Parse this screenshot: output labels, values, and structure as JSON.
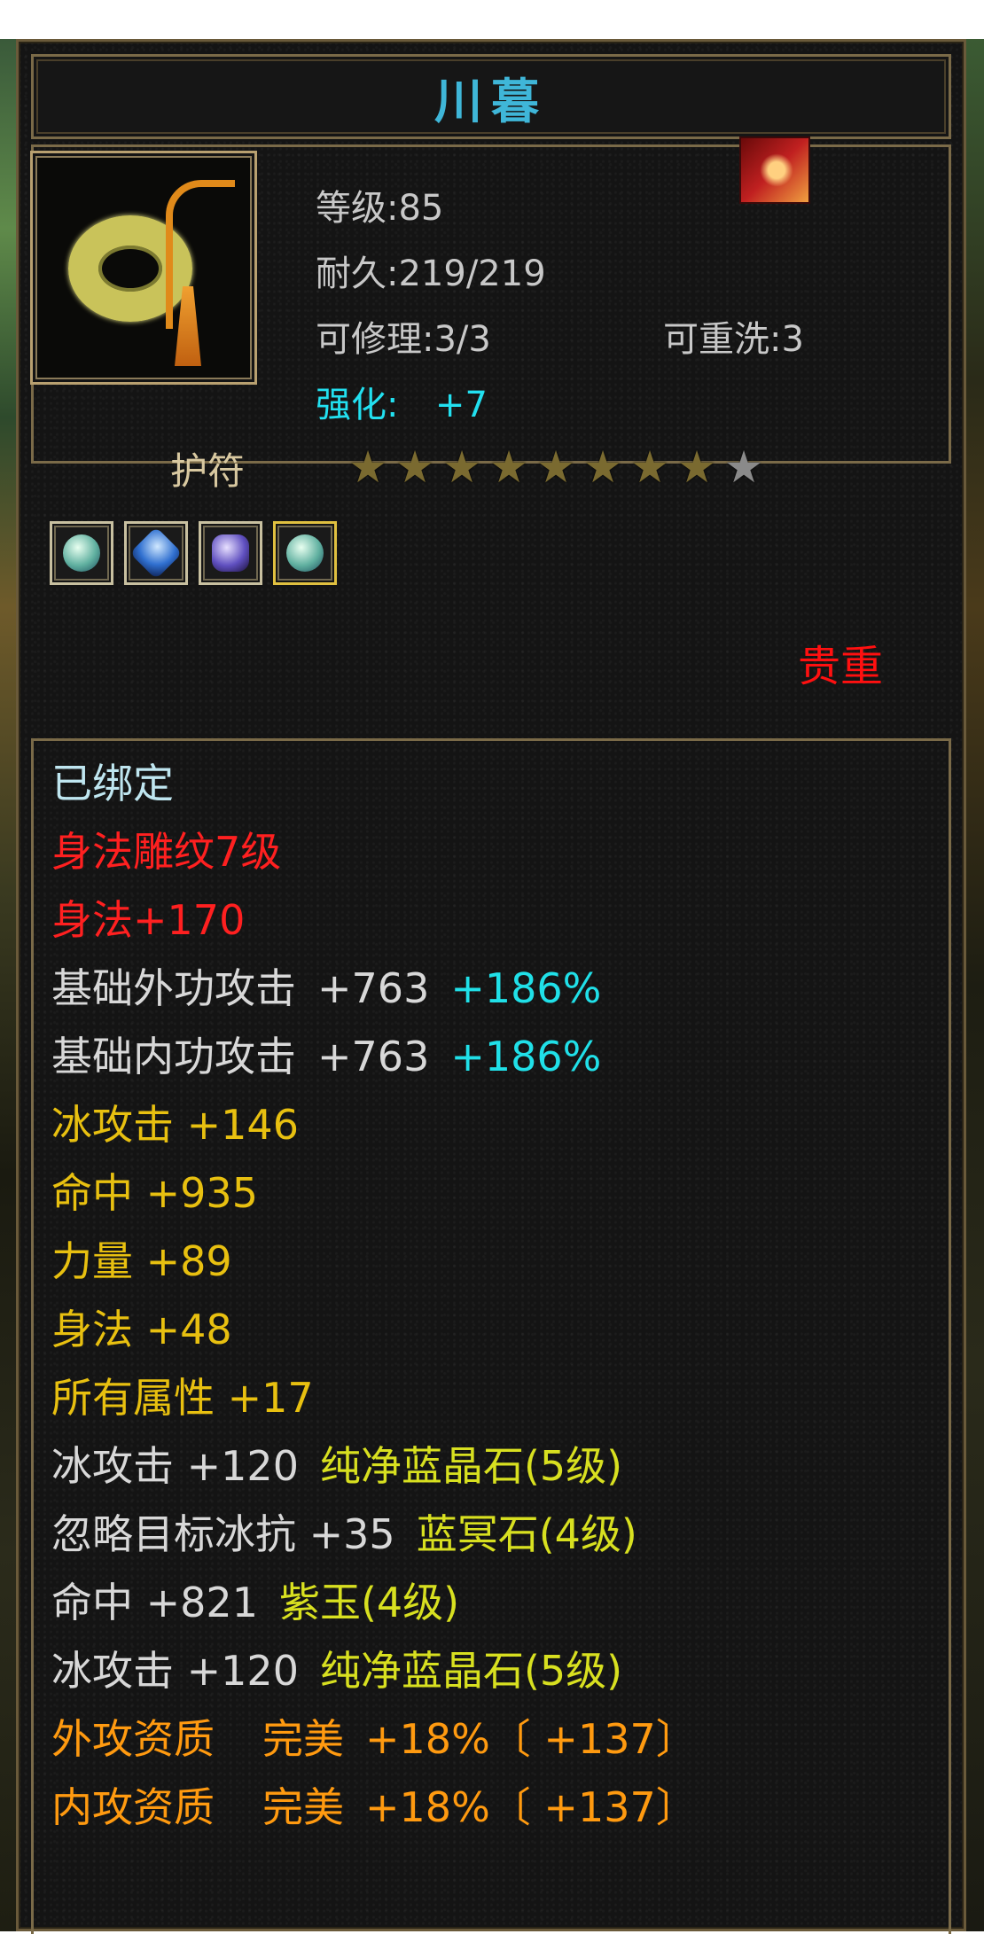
{
  "item": {
    "name": "川暮",
    "level": "等级:85",
    "durability": "耐久:219/219",
    "repairable": "可修理:3/3",
    "rewashable": "可重洗:3",
    "enhance_label": "强化:",
    "enhance_value": "+7"
  },
  "slot": {
    "type": "护符",
    "stars_filled": 8,
    "stars_total": 9,
    "gems": [
      "blue-crystal-gem",
      "blue-sapphire-gem",
      "purple-jade-gem",
      "blue-crystal-gem"
    ],
    "selected_gem_index": 3,
    "rarity": "贵重"
  },
  "attributes": {
    "bound": "已绑定",
    "engrave": "身法雕纹7级",
    "agility_bonus": "身法+170",
    "ext_attack_label": "基础外功攻击",
    "ext_attack_value": "+763",
    "ext_attack_pct": "+186%",
    "int_attack_label": "基础内功攻击",
    "int_attack_value": "+763",
    "int_attack_pct": "+186%",
    "ice_attack": "冰攻击  +146",
    "hit": "命中  +935",
    "strength": "力量  +89",
    "agility": "身法  +48",
    "all_attr": "所有属性  +17",
    "gem_lines": [
      {
        "stat": "冰攻击  +120",
        "gem": "纯净蓝晶石(5级)"
      },
      {
        "stat": "忽略目标冰抗  +35",
        "gem": "蓝冥石(4级)"
      },
      {
        "stat": "命中  +821",
        "gem": "紫玉(4级)"
      },
      {
        "stat": "冰攻击  +120",
        "gem": "纯净蓝晶石(5级)"
      }
    ],
    "ext_aptitude": {
      "label": "外攻资质",
      "grade": "完美",
      "value": "+18%〔 +137〕"
    },
    "int_aptitude": {
      "label": "内攻资质",
      "grade": "完美",
      "value": "+18%〔 +137〕"
    }
  },
  "colors": {
    "title": "#3fb6d8",
    "precious": "#ff1010",
    "bound": "#bfe6f0",
    "red": "#ff2020",
    "yellow": "#e8c010",
    "orange": "#ff9a10",
    "cyan": "#22e0f0"
  }
}
